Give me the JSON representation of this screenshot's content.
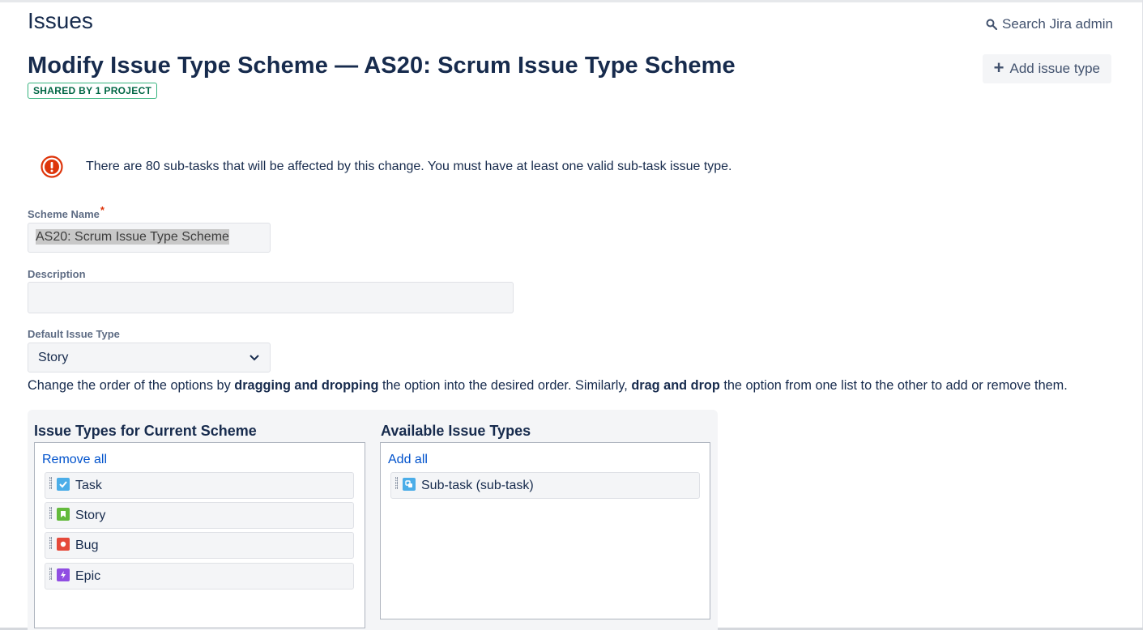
{
  "header": {
    "page_title": "Issues",
    "search_label": "Search Jira admin"
  },
  "scheme": {
    "title": "Modify Issue Type Scheme — AS20: Scrum Issue Type Scheme",
    "shared_badge": "SHARED BY 1 PROJECT",
    "add_issue_type_label": "Add issue type"
  },
  "warning": {
    "message": "There are 80 sub-tasks that will be affected by this change. You must have at least one valid sub-task issue type."
  },
  "form": {
    "scheme_name_label": "Scheme Name",
    "required_marker": "*",
    "scheme_name_value": "AS20: Scrum Issue Type Scheme",
    "description_label": "Description",
    "description_value": "",
    "default_issue_type_label": "Default Issue Type",
    "default_issue_type_value": "Story"
  },
  "instructions": {
    "part1": "Change the order of the options by ",
    "bold1": "dragging and dropping",
    "part2": " the option into the desired order. Similarly, ",
    "bold2": "drag and drop",
    "part3": " the option from one list to the other to add or remove them."
  },
  "current_list": {
    "title": "Issue Types for Current Scheme",
    "action": "Remove all",
    "items": [
      {
        "label": "Task",
        "icon": "task-icon",
        "color": "#4bade8"
      },
      {
        "label": "Story",
        "icon": "story-icon",
        "color": "#63ba3c"
      },
      {
        "label": "Bug",
        "icon": "bug-icon",
        "color": "#e5493a"
      },
      {
        "label": "Epic",
        "icon": "epic-icon",
        "color": "#904ee2"
      }
    ]
  },
  "available_list": {
    "title": "Available Issue Types",
    "action": "Add all",
    "items": [
      {
        "label": "Sub-task (sub-task)",
        "icon": "subtask-icon",
        "color": "#4bade8"
      }
    ]
  }
}
